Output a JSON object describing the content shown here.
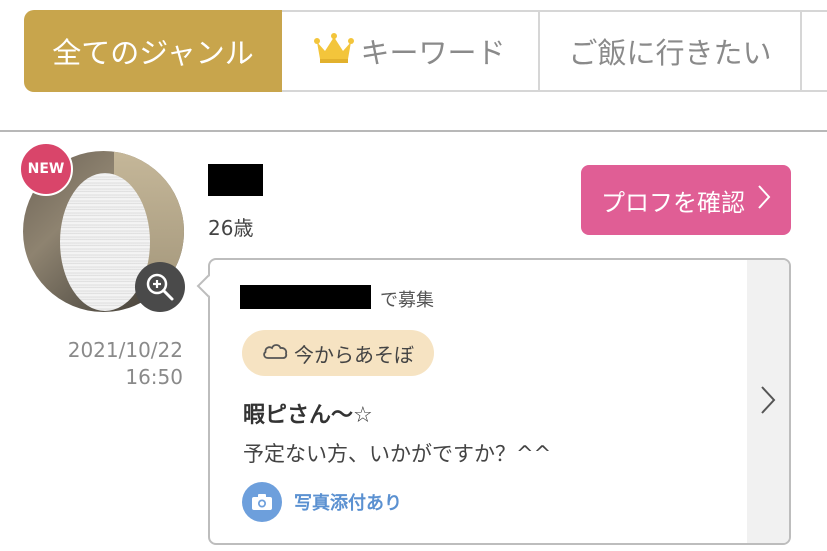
{
  "tabs": [
    {
      "label": "全てのジャンル",
      "active": true
    },
    {
      "label": "キーワード",
      "icon": "crown-icon"
    },
    {
      "label": "ご飯に行きたい"
    }
  ],
  "profile": {
    "badge": "NEW",
    "age": "26歳",
    "profile_button": "プロフを確認",
    "date": "2021/10/22",
    "time": "16:50"
  },
  "post": {
    "recruit_suffix": "で募集",
    "tag": "今からあそぼ",
    "title": "暇ピさん〜☆",
    "description": "予定ない方、いかがですか？^^",
    "photo_label": "写真添付あり"
  },
  "colors": {
    "active_tab": "#c8a54c",
    "badge": "#d9456a",
    "profile_button": "#e05e95",
    "tag_bg": "#f6e3c2",
    "photo_accent": "#5b91d1"
  }
}
